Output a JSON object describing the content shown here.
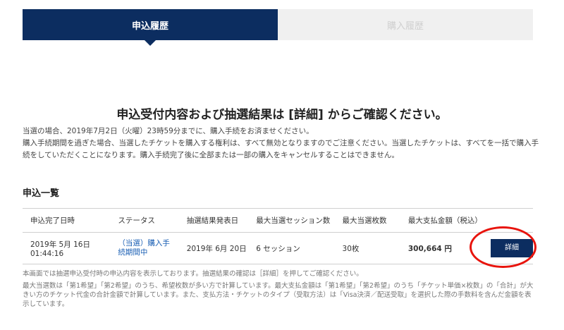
{
  "tabs": {
    "active_label": "申込履歴",
    "inactive_label": "購入履歴"
  },
  "headline": "申込受付内容および抽選結果は [詳細] からご確認ください。",
  "notice": {
    "line1": "当選の場合、2019年7月2日（火曜）23時59分までに、購入手続をお済ませください。",
    "line2": "購入手続期間を過ぎた場合、当選したチケットを購入する権利は、すべて無効となりますのでご注意ください。当選したチケットは、すべてを一括で購入手続をしていただくことになります。購入手続完了後に全部または一部の購入をキャンセルすることはできません。"
  },
  "section_title": "申込一覧",
  "table": {
    "headers": [
      "申込完了日時",
      "ステータス",
      "抽選結果発表日",
      "最大当選セッション数",
      "最大当選枚数",
      "最大支払金額（税込）"
    ],
    "row": {
      "date": "2019年 5月 16日",
      "time": "01:44:16",
      "status": "（当選）購入手続期間中",
      "result_date": "2019年 6月 20日",
      "sessions": "6 セッション",
      "tickets": "30枚",
      "amount": "300,664 円",
      "detail_label": "詳細"
    }
  },
  "notes": {
    "note1": "本画面では抽選申込受付時の申込内容を表示しております。抽選結果の確認は［詳細］を押してご確認ください。",
    "note2": "最大当選数は「第1希望」「第2希望」のうち、希望枚数が多い方で計算しています。最大支払金額は「第1希望」「第2希望」のうち「チケット単価×枚数」の「合計」が大きい方のチケット代金の合計金額で計算しています。また、支払方法・チケットのタイプ（受取方法）は「Visa決済／配送受取」を選択した際の手数料を含んだ金額を表示しています。"
  },
  "colors": {
    "primary": "#0c2d60",
    "link": "#1a5fb4",
    "highlight": "#e8140d"
  }
}
